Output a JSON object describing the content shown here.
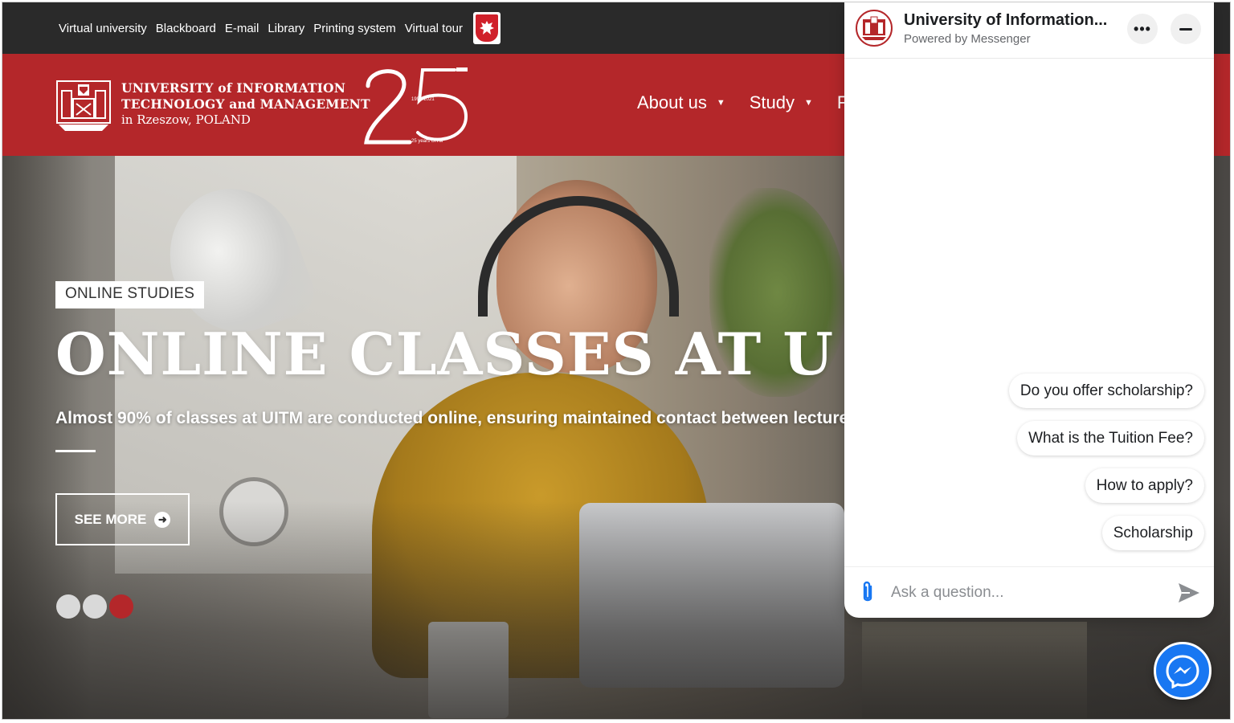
{
  "topbar": {
    "links": [
      "Virtual university",
      "Blackboard",
      "E-mail",
      "Library",
      "Printing system",
      "Virtual tour"
    ],
    "flag_icon": "polish-eagle-icon"
  },
  "header": {
    "name_line1": "UNIVERSITY of INFORMATION",
    "name_line2": "TECHNOLOGY and MANAGEMENT",
    "name_line3": "in Rzeszow, POLAND",
    "anniversary_number": "25",
    "anniversary_years": "1996-2021",
    "anniversary_caption": "25 years UITM",
    "nav": [
      {
        "label": "About us"
      },
      {
        "label": "Study"
      },
      {
        "label": "F"
      }
    ]
  },
  "hero": {
    "tag": "ONLINE STUDIES",
    "headline": "ONLINE CLASSES AT U",
    "subline": "Almost 90% of classes at UITM are conducted online, ensuring maintained contact between lecture",
    "button_label": "SEE MORE",
    "slides_total": 3,
    "active_slide": 3,
    "colors": {
      "dot_inactive": "#d9d9d9",
      "dot_active": "#b4272a"
    }
  },
  "chat": {
    "title": "University of Information...",
    "subtitle": "Powered by Messenger",
    "more_icon": "more-options-icon",
    "minimize_icon": "minimize-icon",
    "suggestions": [
      "Do you offer scholarship?",
      "What is the Tuition Fee?",
      "How to apply?",
      "Scholarship"
    ],
    "input_placeholder": "Ask a question...",
    "attach_icon": "paperclip-icon",
    "send_icon": "send-icon"
  },
  "fab": {
    "icon": "messenger-icon"
  },
  "colors": {
    "brand_red": "#b4272a",
    "topbar": "#2a2a2a",
    "messenger_blue": "#1877f2"
  }
}
